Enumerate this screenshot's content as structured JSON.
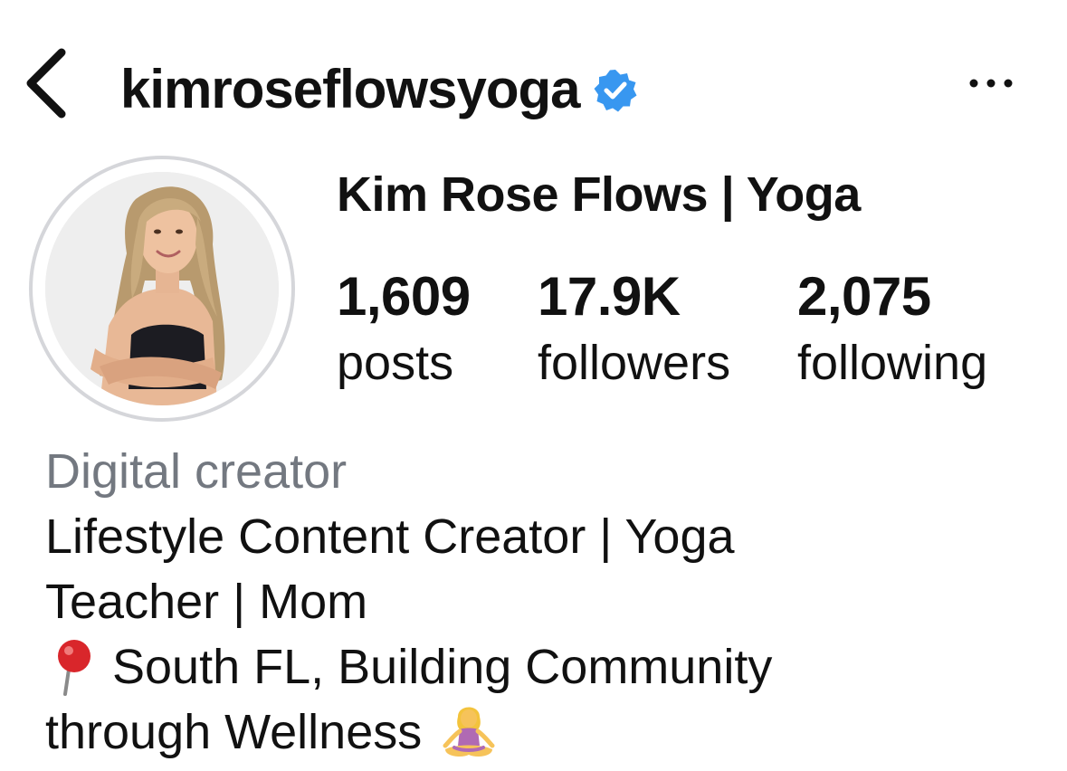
{
  "header": {
    "back_icon": "chevron-left-icon",
    "username": "kimroseflowsyoga",
    "verified_icon": "verified-badge-icon",
    "verified_color": "#3897f0",
    "more_icon": "ellipsis-icon"
  },
  "profile": {
    "display_name": "Kim Rose Flows | Yoga",
    "avatar_ring_color": "#d5d6da"
  },
  "stats": {
    "posts": {
      "count": "1,609",
      "label": "posts"
    },
    "followers": {
      "count": "17.9K",
      "label": "followers"
    },
    "following": {
      "count": "2,075",
      "label": "following"
    }
  },
  "bio": {
    "category": "Digital creator",
    "category_color": "#737880",
    "line1": "Lifestyle Content Creator | Yoga",
    "line2": "Teacher | Mom",
    "line3_icon": "round-pushpin-icon",
    "line3": "South FL, Building Community",
    "line4": "through Wellness",
    "line4_icon": "person-in-lotus-position-icon"
  }
}
